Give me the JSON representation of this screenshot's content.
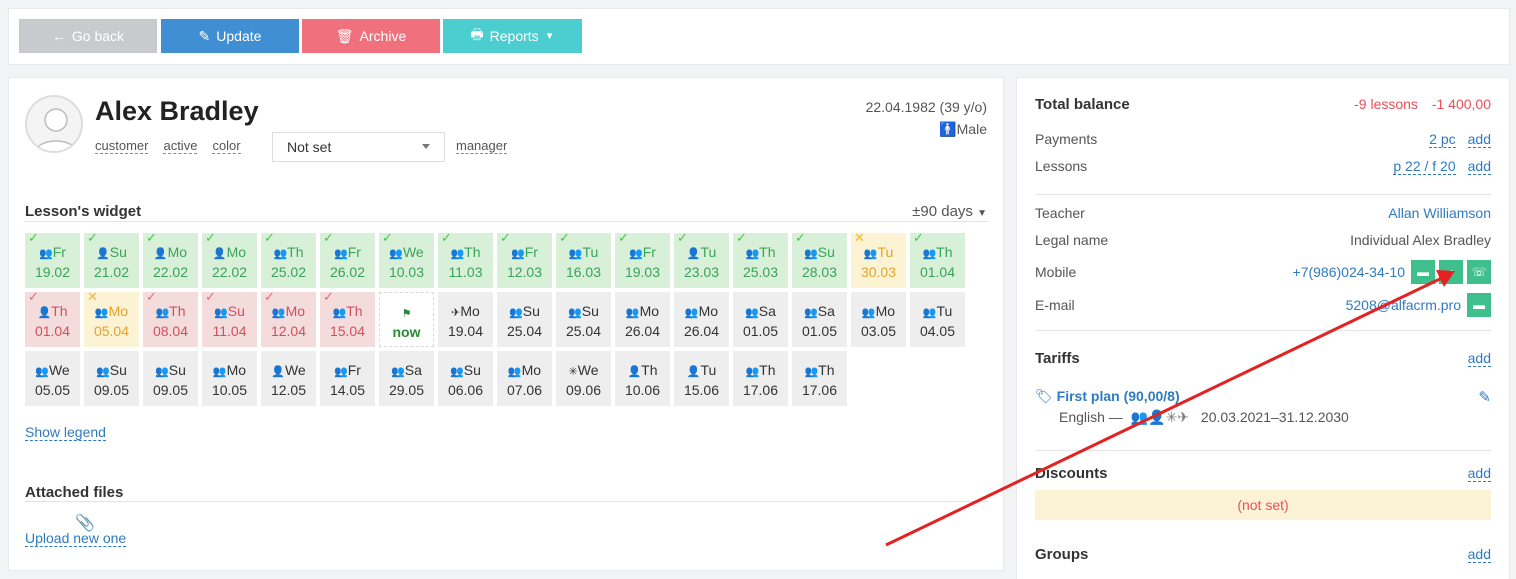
{
  "toolbar": {
    "back_label": "Go back",
    "update_label": "Update",
    "archive_label": "Archive",
    "reports_label": "Reports"
  },
  "profile": {
    "name": "Alex Bradley",
    "tags": [
      "customer",
      "active",
      "color"
    ],
    "status_select": "Not set",
    "manager_label": "manager",
    "dob": "22.04.1982 (39 y/o)",
    "gender": "Male"
  },
  "lessons_widget": {
    "title": "Lesson's widget",
    "range": "±90 days",
    "rows": [
      [
        {
          "day": "Fr",
          "date": "19.02",
          "s": "g",
          "ic": "group",
          "m": "check"
        },
        {
          "day": "Su",
          "date": "21.02",
          "s": "g",
          "ic": "person",
          "m": "check"
        },
        {
          "day": "Mo",
          "date": "22.02",
          "s": "g",
          "ic": "person",
          "m": "check"
        },
        {
          "day": "Mo",
          "date": "22.02",
          "s": "g",
          "ic": "person",
          "m": "check"
        },
        {
          "day": "Th",
          "date": "25.02",
          "s": "g",
          "ic": "group",
          "m": "check"
        },
        {
          "day": "Fr",
          "date": "26.02",
          "s": "g",
          "ic": "group",
          "m": "check"
        },
        {
          "day": "We",
          "date": "10.03",
          "s": "g",
          "ic": "group",
          "m": "check"
        },
        {
          "day": "Th",
          "date": "11.03",
          "s": "g",
          "ic": "group",
          "m": "check"
        },
        {
          "day": "Fr",
          "date": "12.03",
          "s": "g",
          "ic": "group",
          "m": "check"
        },
        {
          "day": "Tu",
          "date": "16.03",
          "s": "g",
          "ic": "group",
          "m": "check"
        },
        {
          "day": "Fr",
          "date": "19.03",
          "s": "g",
          "ic": "group",
          "m": "check"
        },
        {
          "day": "Tu",
          "date": "23.03",
          "s": "g",
          "ic": "person",
          "m": "check"
        },
        {
          "day": "Th",
          "date": "25.03",
          "s": "g",
          "ic": "group",
          "m": "check"
        },
        {
          "day": "Su",
          "date": "28.03",
          "s": "g",
          "ic": "group",
          "m": "check"
        },
        {
          "day": "Tu",
          "date": "30.03",
          "s": "y",
          "ic": "group",
          "m": "cross"
        },
        {
          "day": "Th",
          "date": "01.04",
          "s": "g",
          "ic": "group",
          "m": "check"
        }
      ],
      [
        {
          "day": "Th",
          "date": "01.04",
          "s": "r",
          "ic": "person",
          "m": "check"
        },
        {
          "day": "Mo",
          "date": "05.04",
          "s": "y",
          "ic": "group",
          "m": "cross"
        },
        {
          "day": "Th",
          "date": "08.04",
          "s": "r",
          "ic": "group",
          "m": "check"
        },
        {
          "day": "Su",
          "date": "11.04",
          "s": "r",
          "ic": "group",
          "m": "check"
        },
        {
          "day": "Mo",
          "date": "12.04",
          "s": "r",
          "ic": "group",
          "m": "check"
        },
        {
          "day": "Th",
          "date": "15.04",
          "s": "r",
          "ic": "group",
          "m": "check"
        },
        {
          "day": "",
          "date": "now",
          "s": "w",
          "ic": "flag",
          "m": ""
        },
        {
          "day": "Mo",
          "date": "19.04",
          "s": "n",
          "ic": "send",
          "m": ""
        },
        {
          "day": "Su",
          "date": "25.04",
          "s": "n",
          "ic": "group",
          "m": ""
        },
        {
          "day": "Su",
          "date": "25.04",
          "s": "n",
          "ic": "group",
          "m": ""
        },
        {
          "day": "Mo",
          "date": "26.04",
          "s": "n",
          "ic": "group",
          "m": ""
        },
        {
          "day": "Mo",
          "date": "26.04",
          "s": "n",
          "ic": "group",
          "m": ""
        },
        {
          "day": "Sa",
          "date": "01.05",
          "s": "n",
          "ic": "group",
          "m": ""
        },
        {
          "day": "Sa",
          "date": "01.05",
          "s": "n",
          "ic": "group",
          "m": ""
        },
        {
          "day": "Mo",
          "date": "03.05",
          "s": "n",
          "ic": "group",
          "m": ""
        },
        {
          "day": "Tu",
          "date": "04.05",
          "s": "n",
          "ic": "group",
          "m": ""
        }
      ],
      [
        {
          "day": "We",
          "date": "05.05",
          "s": "n",
          "ic": "group",
          "m": ""
        },
        {
          "day": "Su",
          "date": "09.05",
          "s": "n",
          "ic": "group",
          "m": ""
        },
        {
          "day": "Su",
          "date": "09.05",
          "s": "n",
          "ic": "group",
          "m": ""
        },
        {
          "day": "Mo",
          "date": "10.05",
          "s": "n",
          "ic": "group",
          "m": ""
        },
        {
          "day": "We",
          "date": "12.05",
          "s": "n",
          "ic": "person",
          "m": ""
        },
        {
          "day": "Fr",
          "date": "14.05",
          "s": "n",
          "ic": "group",
          "m": ""
        },
        {
          "day": "Sa",
          "date": "29.05",
          "s": "n",
          "ic": "group",
          "m": ""
        },
        {
          "day": "Su",
          "date": "06.06",
          "s": "n",
          "ic": "group",
          "m": ""
        },
        {
          "day": "Mo",
          "date": "07.06",
          "s": "n",
          "ic": "group",
          "m": ""
        },
        {
          "day": "We",
          "date": "09.06",
          "s": "n",
          "ic": "snow",
          "m": ""
        },
        {
          "day": "Th",
          "date": "10.06",
          "s": "n",
          "ic": "person",
          "m": ""
        },
        {
          "day": "Tu",
          "date": "15.06",
          "s": "n",
          "ic": "person",
          "m": ""
        },
        {
          "day": "Th",
          "date": "17.06",
          "s": "n",
          "ic": "group",
          "m": ""
        },
        {
          "day": "Th",
          "date": "17.06",
          "s": "n",
          "ic": "group",
          "m": ""
        }
      ]
    ],
    "show_legend": "Show legend"
  },
  "files": {
    "title": "Attached files",
    "upload": "Upload new one"
  },
  "sidebar": {
    "total_balance_label": "Total balance",
    "balance_lessons": "-9 lessons",
    "balance_money": "-1 400,00",
    "payments_label": "Payments",
    "payments_value": "2 pc",
    "lessons_label": "Lessons",
    "lessons_value": "p 22 / f 20",
    "add": "add",
    "teacher_label": "Teacher",
    "teacher_value": "Allan Williamson",
    "legal_label": "Legal name",
    "legal_value": "Individual Alex Bradley",
    "mobile_label": "Mobile",
    "mobile_value": "+7(986)024-34-10",
    "email_label": "E-mail",
    "email_value": "5208@alfacrm.pro",
    "tariffs_label": "Tariffs",
    "plan_name": "First plan (90,00/8)",
    "plan_subject": "English —",
    "plan_period": "20.03.2021–31.12.2030",
    "discounts_label": "Discounts",
    "discounts_value": "(not set)",
    "groups_label": "Groups"
  }
}
